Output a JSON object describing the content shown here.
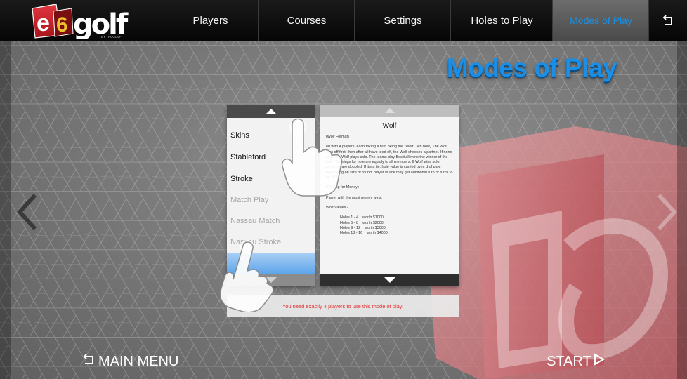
{
  "header": {
    "logo_text": "e6golf",
    "logo_subtext": "BY TRUGOLF",
    "tabs": [
      {
        "label": "Players"
      },
      {
        "label": "Courses"
      },
      {
        "label": "Settings"
      },
      {
        "label": "Holes to Play"
      },
      {
        "label": "Modes of Play",
        "active": true
      }
    ],
    "back_icon": "return-arrow-icon"
  },
  "page_title": "Modes of Play",
  "modes": {
    "items": [
      {
        "label": "Skins",
        "enabled": true
      },
      {
        "label": "Stableford",
        "enabled": true
      },
      {
        "label": "Stroke",
        "enabled": true
      },
      {
        "label": "Match Play",
        "enabled": false
      },
      {
        "label": "Nassau Match",
        "enabled": false
      },
      {
        "label": "Nassau Stroke",
        "enabled": false
      }
    ]
  },
  "description": {
    "title": "Wolf",
    "format": "(Wolf Format)",
    "body": "ed with 4 players, each taking a turn being the \"Wolf\". 4th hole) The Wolf tees off first, then after all have teed off, the Wolf chooses a partner. If none cted, the Wolf plays solo. The teams play Bestball mine the winner of the hole. Winnings for hole are equally to all members. If Wolf wins solo, winnings are doubled. If it's a tie, hole value is carried over. d of play, depending on size of round, player in ace may get additional turn or turns to be Wolf.",
    "money_heading": "(Playing for Money)",
    "money_text": "Player with the most money wins.",
    "values_heading": "Wolf Values -",
    "values": [
      {
        "holes": "Holes  1 - 4",
        "worth": "worth  $1000"
      },
      {
        "holes": "Holes  5 - 8",
        "worth": "worth  $2000"
      },
      {
        "holes": "Holes  9 - 12",
        "worth": "worth  $3000"
      },
      {
        "holes": "Holes  13 - 16",
        "worth": "worth  $4000"
      }
    ]
  },
  "message": "You need exactly 4 players to use this mode of play.",
  "footer": {
    "main_menu": "MAIN MENU",
    "start": "START"
  },
  "colors": {
    "accent_blue": "#1b8ee6",
    "selected_blue": "#5ea5ea",
    "error_red": "#e23030",
    "brand_red": "#c8232c"
  }
}
